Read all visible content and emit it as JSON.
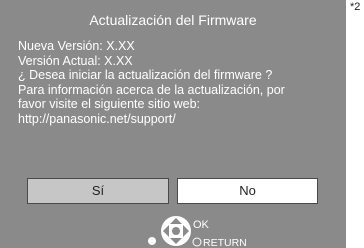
{
  "dialog": {
    "title": "Actualización del Firmware",
    "lines": [
      "Nueva Versión:  X.XX",
      "Versión Actual:  X.XX",
      "¿ Desea iniciar la actualización del firmware ?",
      "Para información acerca de la actualización, por",
      "favor visite el siguiente sitio web:",
      "http://panasonic.net/support/"
    ],
    "buttons": {
      "yes": "Sí",
      "no": "No"
    },
    "nav": {
      "ok": "OK",
      "return": "RETURN"
    }
  },
  "marker": "*2",
  "colors": {
    "background": "#8a8a8a",
    "selected_button": "#ffffff",
    "unselected_button": "#c6c6c6"
  }
}
